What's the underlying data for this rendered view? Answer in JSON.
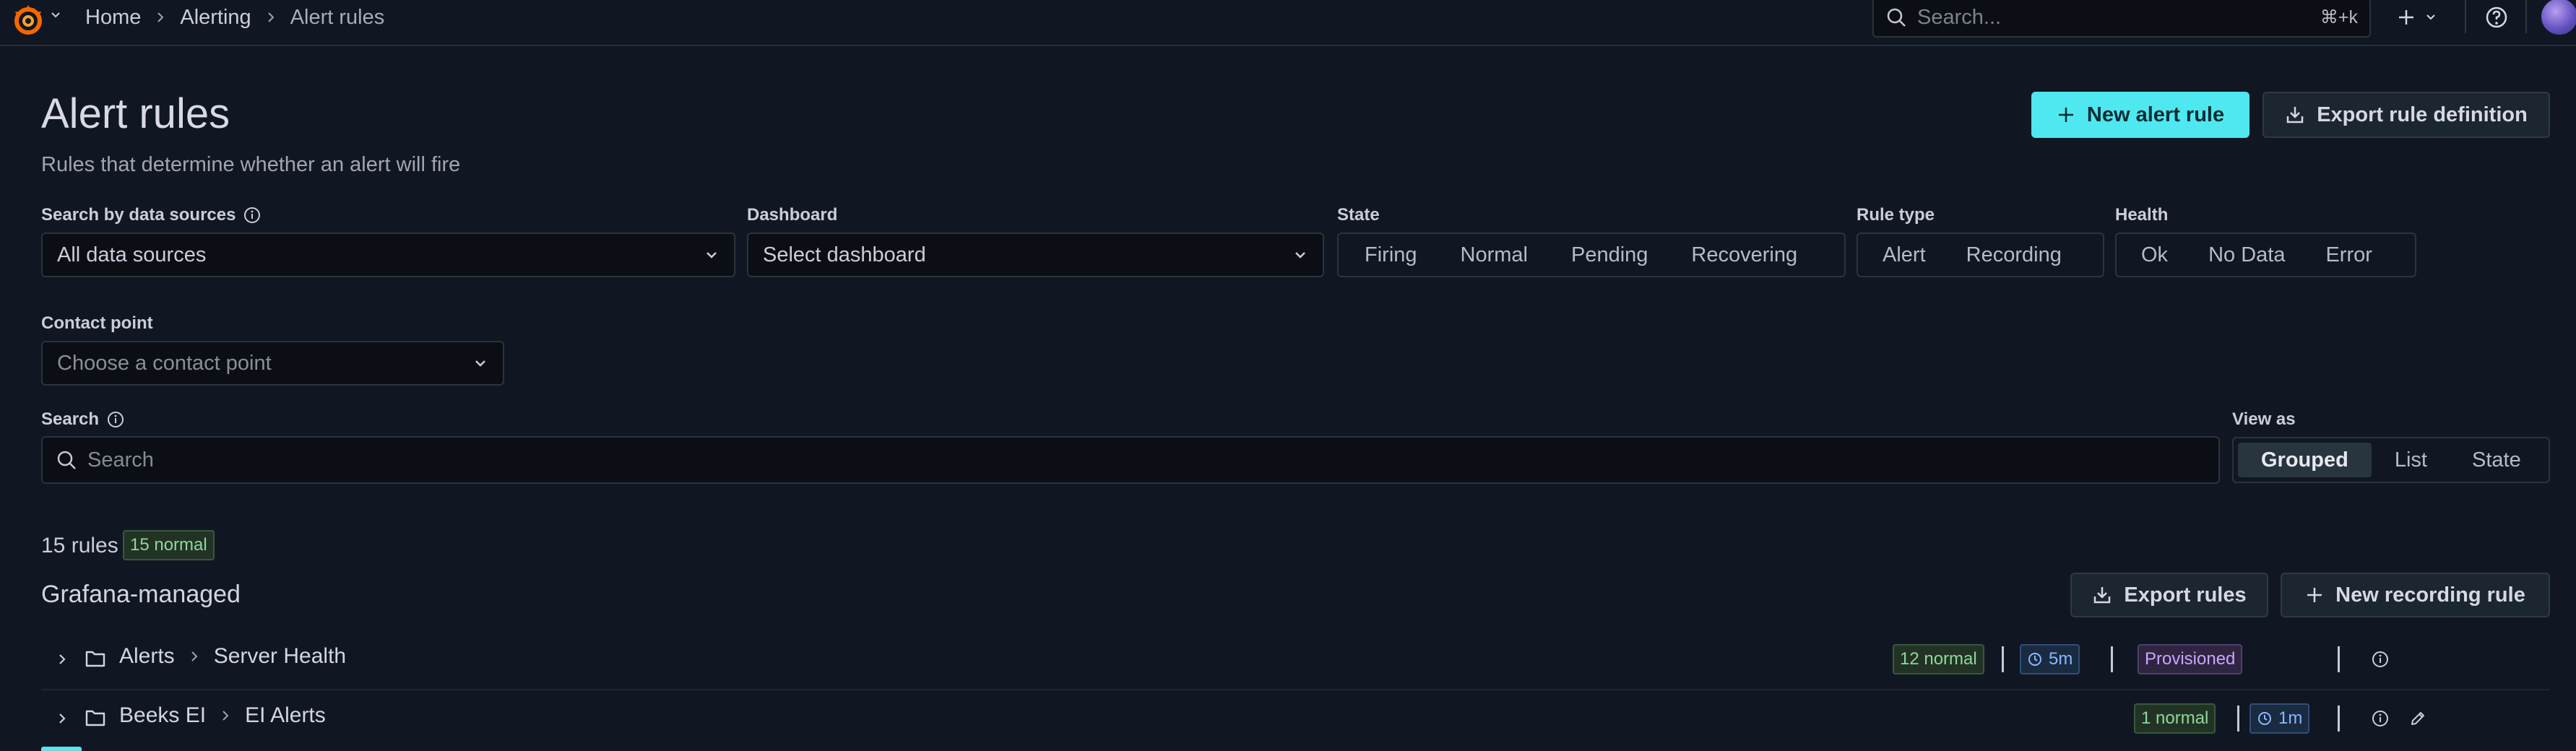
{
  "breadcrumb": {
    "home": "Home",
    "alerting": "Alerting",
    "current": "Alert rules"
  },
  "top_search": {
    "placeholder": "Search...",
    "shortcut": "⌘+k"
  },
  "header": {
    "title": "Alert rules",
    "subtitle": "Rules that determine whether an alert will fire",
    "new_alert_rule": "New alert rule",
    "export_rule_definition": "Export rule definition"
  },
  "filters": {
    "data_sources": {
      "label": "Search by data sources",
      "value": "All data sources"
    },
    "dashboard": {
      "label": "Dashboard",
      "placeholder": "Select dashboard"
    },
    "state": {
      "label": "State",
      "options": [
        "Firing",
        "Normal",
        "Pending",
        "Recovering"
      ]
    },
    "rule_type": {
      "label": "Rule type",
      "options": [
        "Alert",
        "Recording"
      ]
    },
    "health": {
      "label": "Health",
      "options": [
        "Ok",
        "No Data",
        "Error"
      ]
    },
    "contact_point": {
      "label": "Contact point",
      "placeholder": "Choose a contact point"
    },
    "search": {
      "label": "Search",
      "placeholder": "Search"
    },
    "view_as": {
      "label": "View as",
      "options": [
        "Grouped",
        "List",
        "State"
      ],
      "selected": "Grouped"
    }
  },
  "summary": {
    "rules_count": "15 rules",
    "normal_badge": "15 normal"
  },
  "grafana_managed": {
    "title": "Grafana-managed",
    "export_rules": "Export rules",
    "new_recording_rule": "New recording rule",
    "groups": [
      {
        "folder": "Alerts",
        "group": "Server Health",
        "normal": "12 normal",
        "interval": "5m",
        "provisioned": "Provisioned"
      },
      {
        "folder": "Beeks EI",
        "group": "EI Alerts",
        "normal": "1 normal",
        "interval": "1m"
      }
    ]
  },
  "colors": {
    "background": "#111722",
    "primary_button": "#4fe8f0",
    "badge_green": "#8fd79a",
    "badge_blue": "#8ab8ff",
    "badge_purple": "#c7a6ff"
  }
}
